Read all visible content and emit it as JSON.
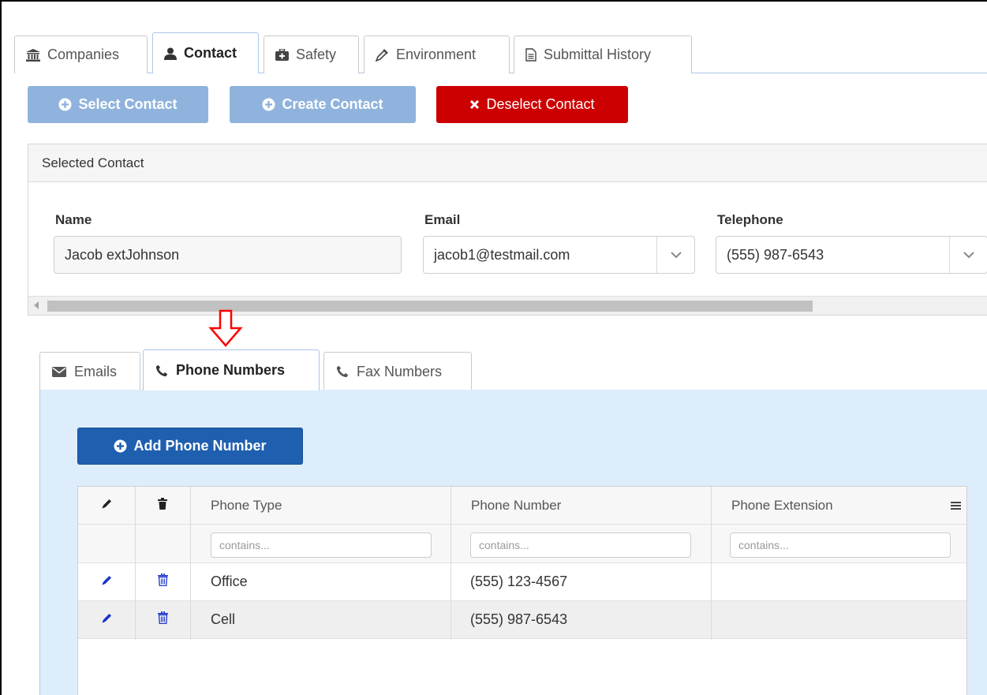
{
  "top_tabs": [
    {
      "label": "Companies",
      "icon": "bank-icon"
    },
    {
      "label": "Contact",
      "icon": "user-icon"
    },
    {
      "label": "Safety",
      "icon": "medkit-icon"
    },
    {
      "label": "Environment",
      "icon": "eyedropper-icon"
    },
    {
      "label": "Submittal History",
      "icon": "document-icon"
    }
  ],
  "active_top_tab": "Contact",
  "actions": {
    "select_contact": "Select Contact",
    "create_contact": "Create Contact",
    "deselect_contact": "Deselect Contact"
  },
  "selected_contact": {
    "heading": "Selected Contact",
    "name_label": "Name",
    "name_value": "Jacob extJohnson",
    "email_label": "Email",
    "email_value": "jacob1@testmail.com",
    "telephone_label": "Telephone",
    "telephone_value": "(555) 987-6543"
  },
  "sub_tabs": [
    {
      "label": "Emails",
      "icon": "envelope-icon"
    },
    {
      "label": "Phone Numbers",
      "icon": "phone-icon"
    },
    {
      "label": "Fax Numbers",
      "icon": "phone-icon"
    }
  ],
  "active_sub_tab": "Phone Numbers",
  "add_phone_label": "Add Phone Number",
  "grid": {
    "columns": [
      "Phone Type",
      "Phone Number",
      "Phone Extension"
    ],
    "filter_placeholder": "contains...",
    "rows": [
      {
        "type": "Office",
        "number": "(555) 123-4567",
        "extension": ""
      },
      {
        "type": "Cell",
        "number": "(555) 987-6543",
        "extension": ""
      }
    ]
  },
  "colors": {
    "accent_blue": "#1f5fb0",
    "disabled_blue": "#8fb3dc",
    "danger_red": "#cc0000",
    "annotation_red": "#ff0000",
    "area_blue": "#deedfb"
  }
}
